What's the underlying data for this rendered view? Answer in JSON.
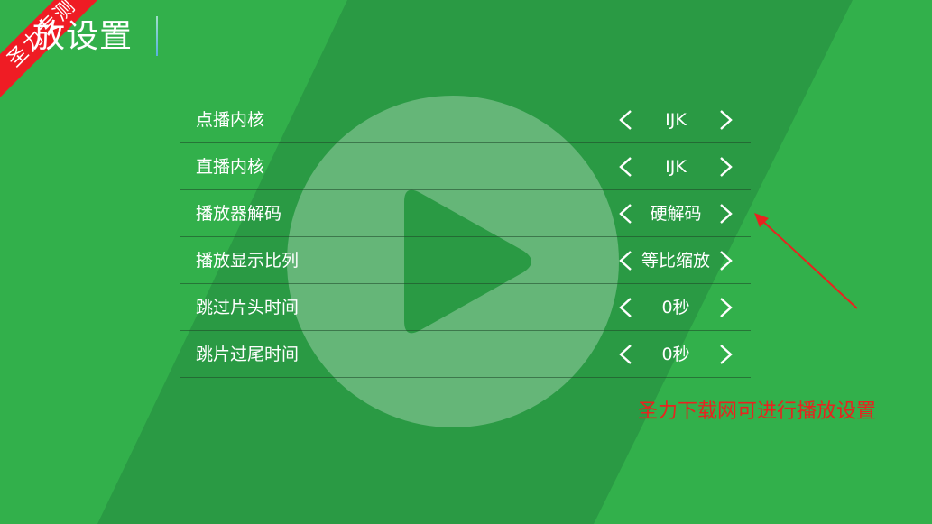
{
  "header": {
    "title": "放设置",
    "ribbon_text": "圣力专测"
  },
  "settings": {
    "rows": [
      {
        "label": "点播内核",
        "value": "IJK"
      },
      {
        "label": "直播内核",
        "value": "IJK"
      },
      {
        "label": "播放器解码",
        "value": "硬解码"
      },
      {
        "label": "播放显示比列",
        "value": "等比缩放"
      },
      {
        "label": "跳过片头时间",
        "value": "0秒"
      },
      {
        "label": "跳片过尾时间",
        "value": "0秒"
      }
    ]
  },
  "annotation": {
    "text": "圣力下载网可进行播放设置"
  },
  "icons": {
    "prev": "chevron-left-icon",
    "next": "chevron-right-icon",
    "watermark": "play-icon"
  },
  "colors": {
    "background": "#32b04b",
    "band": "#2a9a44",
    "ribbon": "#ef1c24",
    "annotation": "#e8231f"
  }
}
